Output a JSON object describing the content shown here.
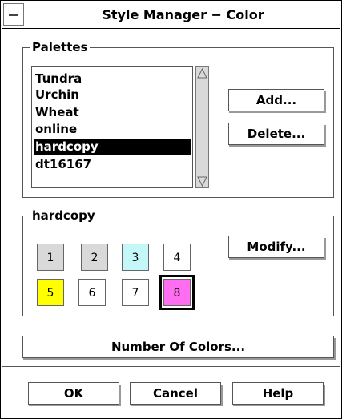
{
  "window": {
    "title": "Style Manager − Color"
  },
  "palettes": {
    "label": "Palettes",
    "items": [
      "Tundra",
      "Urchin",
      "Wheat",
      "online",
      "hardcopy",
      "dt16167"
    ],
    "selected": "hardcopy",
    "add_label": "Add...",
    "delete_label": "Delete..."
  },
  "current_palette": {
    "label": "hardcopy",
    "modify_label": "Modify...",
    "swatches": [
      {
        "label": "1",
        "color": "#d9d9d9"
      },
      {
        "label": "2",
        "color": "#d9d9d9"
      },
      {
        "label": "3",
        "color": "#c4f7f7"
      },
      {
        "label": "4",
        "color": "#ffffff"
      },
      {
        "label": "5",
        "color": "#ffff00"
      },
      {
        "label": "6",
        "color": "#ffffff"
      },
      {
        "label": "7",
        "color": "#ffffff"
      },
      {
        "label": "8",
        "color": "#ff6ef0"
      }
    ],
    "selected_swatch": "8"
  },
  "number_of_colors_label": "Number Of Colors...",
  "footer": {
    "ok_label": "OK",
    "cancel_label": "Cancel",
    "help_label": "Help"
  }
}
